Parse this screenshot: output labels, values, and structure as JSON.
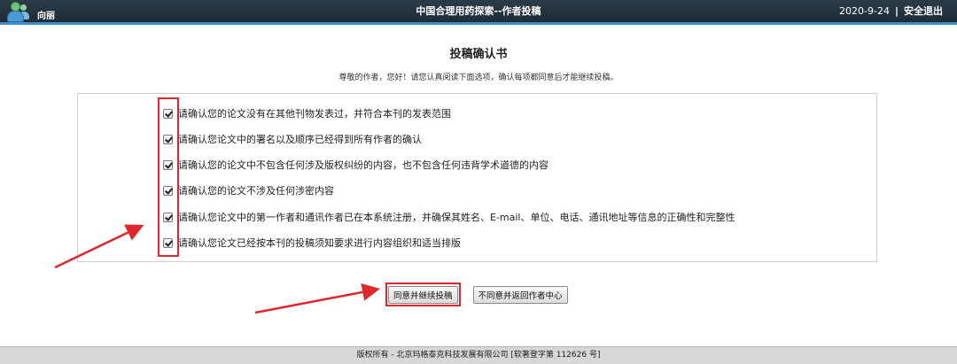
{
  "header": {
    "username": "向丽",
    "title": "中国合理用药探索--作者投稿",
    "date": "2020-9-24",
    "separator": "|",
    "logout_label": "安全退出"
  },
  "main": {
    "title": "投稿确认书",
    "intro": "尊敬的作者，您好！请您认真阅读下面选项，确认每项都同意后才能继续投稿。",
    "items": [
      {
        "label": "请确认您的论文没有在其他刊物发表过，并符合本刊的发表范围",
        "checked": true
      },
      {
        "label": "请确认您论文中的署名以及顺序已经得到所有作者的确认",
        "checked": true
      },
      {
        "label": "请确认您的论文中不包含任何涉及版权纠纷的内容，也不包含任何违背学术道德的内容",
        "checked": true
      },
      {
        "label": "请确认您的论文不涉及任何涉密内容",
        "checked": true
      },
      {
        "label": "请确认您论文中的第一作者和通讯作者已在本系统注册，并确保其姓名、E-mail、单位、电话、通讯地址等信息的正确性和完整性",
        "checked": true
      },
      {
        "label": "请确认您论文已经按本刊的投稿须知要求进行内容组织和适当排版",
        "checked": true
      }
    ],
    "agree_button": "同意并继续投稿",
    "disagree_button": "不同意并返回作者中心"
  },
  "footer": {
    "text": "版权所有 - 北京玛格泰克科技发展有限公司 [软著登字第 112626 号]"
  },
  "colors": {
    "header_bg": "#1f2c36",
    "header_accent": "#3d8ec9",
    "annotation_red": "#e0262b",
    "footer_bg": "#d7d7d7"
  },
  "icons": {
    "user": "user-group-icon"
  }
}
